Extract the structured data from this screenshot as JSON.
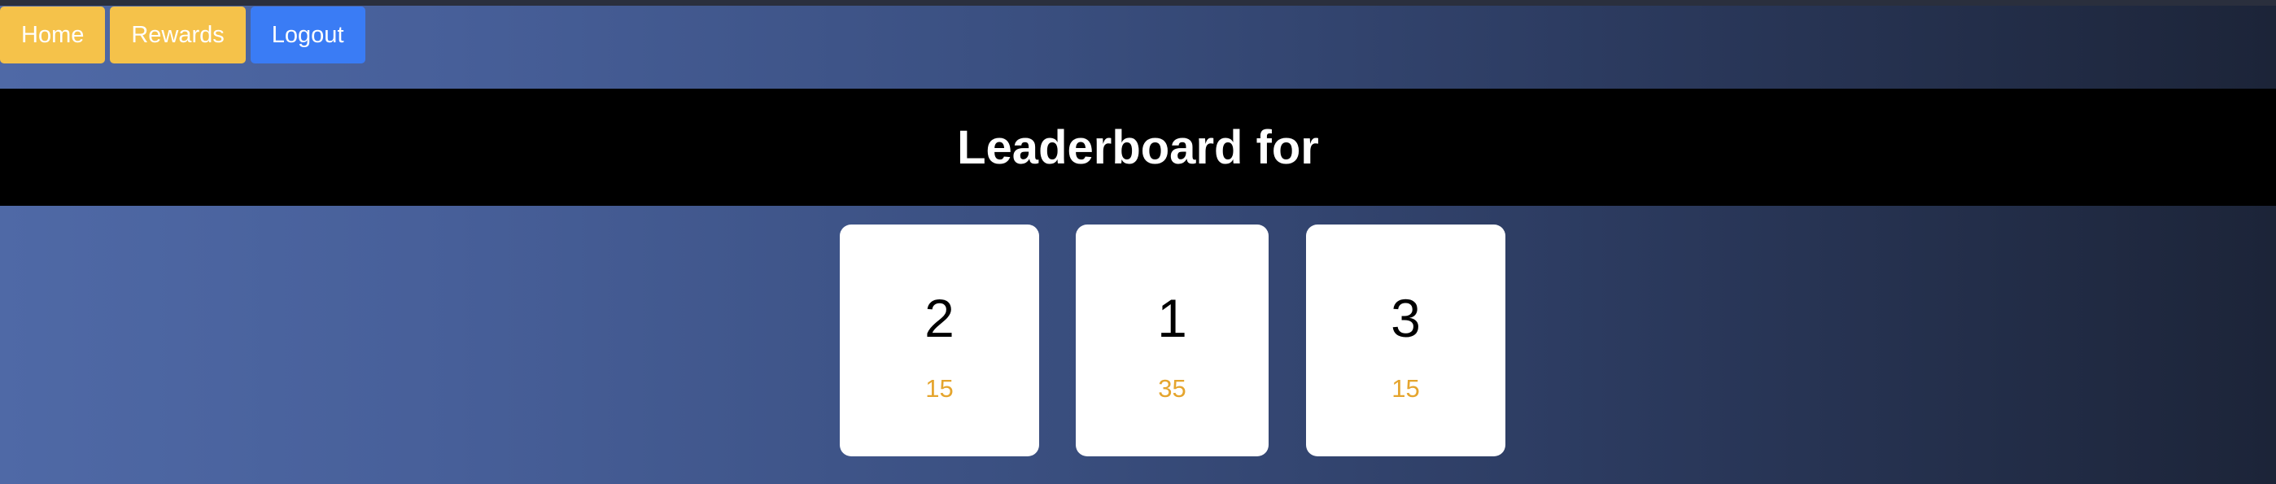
{
  "nav": {
    "home_label": "Home",
    "rewards_label": "Rewards",
    "logout_label": "Logout"
  },
  "header": {
    "title": "Leaderboard for"
  },
  "podium": [
    {
      "rank": "2",
      "points": "15"
    },
    {
      "rank": "1",
      "points": "35"
    },
    {
      "rank": "3",
      "points": "15"
    }
  ],
  "colors": {
    "nav_warning": "#f5c24a",
    "nav_primary": "#3a7cf5",
    "points_accent": "#e5a52e",
    "title_bar": "#000000"
  }
}
